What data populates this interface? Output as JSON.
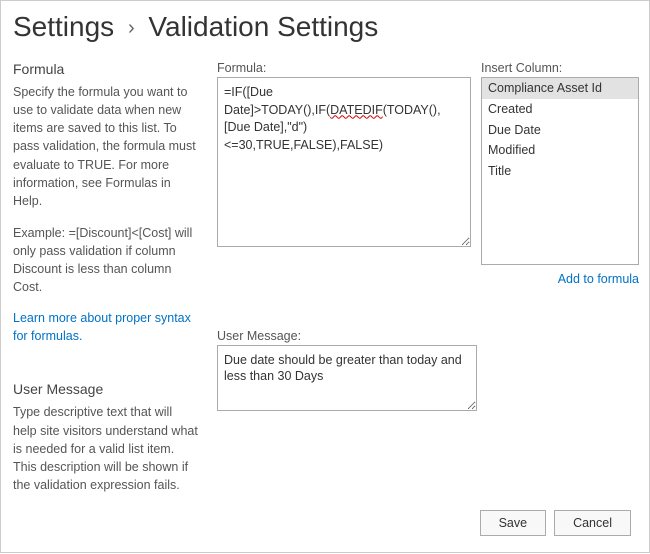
{
  "breadcrumb": {
    "root": "Settings",
    "current": "Validation Settings"
  },
  "formula_section": {
    "title": "Formula",
    "desc": "Specify the formula you want to use to validate data when new items are saved to this list. To pass validation, the formula must evaluate to TRUE. For more information, see Formulas in Help.",
    "example": "Example: =[Discount]<[Cost] will only pass validation if column Discount is less than column Cost.",
    "link": "Learn more about proper syntax for formulas.",
    "field_label": "Formula:",
    "value_pre": "=IF([Due Date]>TODAY(),IF(",
    "value_wavy": "DATEDIF",
    "value_post": "(TODAY(),[Due Date],\"d\")<=30,TRUE,FALSE),FALSE)"
  },
  "insert_column": {
    "label": "Insert Column:",
    "items": [
      "Compliance Asset Id",
      "Created",
      "Due Date",
      "Modified",
      "Title"
    ],
    "selected": 0,
    "add_link": "Add to formula"
  },
  "user_message_section": {
    "title": "User Message",
    "desc": "Type descriptive text that will help site visitors understand what is needed for a valid list item. This description will be shown if the validation expression fails.",
    "field_label": "User Message:",
    "value": "Due date should be greater than today and less than 30 Days"
  },
  "buttons": {
    "save": "Save",
    "cancel": "Cancel"
  }
}
